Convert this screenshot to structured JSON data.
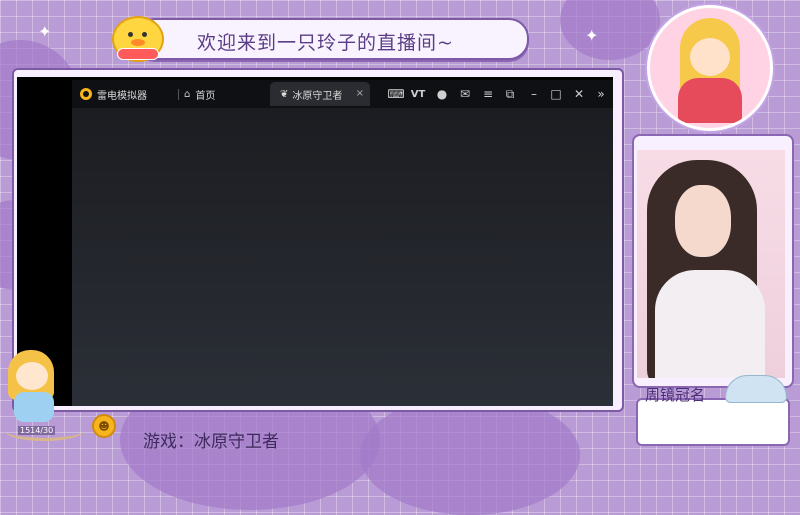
{
  "overlay": {
    "title": "欢迎来到一只玲子的直播间~",
    "game_label": "游戏：冰原守卫者",
    "streamer_tag": "周镜冠名",
    "counter": "1514/30"
  },
  "emulator": {
    "app_name": "雷电模拟器",
    "tabs": [
      {
        "label": "首页",
        "active": false
      },
      {
        "label": "冰原守卫者",
        "active": true
      }
    ],
    "tab_close_glyph": "×",
    "toolbar_icons": [
      "gamepad-icon",
      "vt-icon",
      "user-icon",
      "mail-icon",
      "menu-icon",
      "resize-icon",
      "minimize-icon",
      "maximize-icon",
      "close-icon",
      "collapse-icon"
    ],
    "vt_label": "VT"
  },
  "colors": {
    "background": "#b99bd6",
    "frame_border": "#7d5aa6",
    "emulator_bar": "#0f1013",
    "accent": "#f6b51d"
  }
}
